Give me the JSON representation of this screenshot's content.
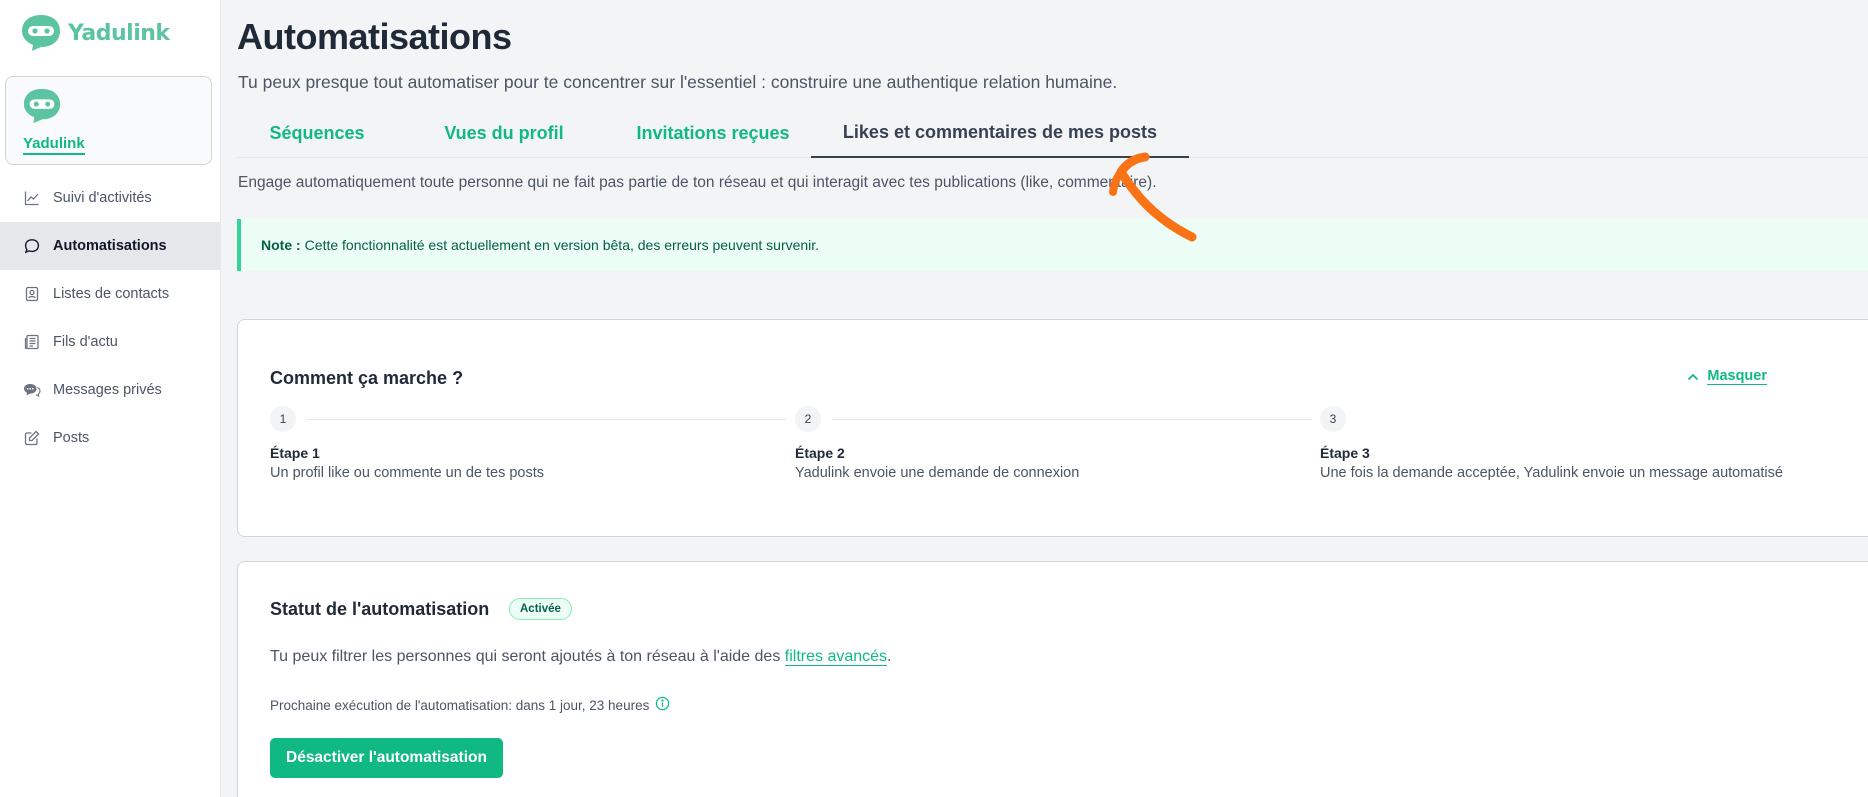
{
  "brand": {
    "name": "Yadulink",
    "color": "#5cc4a0"
  },
  "account": {
    "name": "Yadulink"
  },
  "nav": {
    "items": [
      {
        "label": "Suivi d'activités",
        "icon": "chart-line-icon"
      },
      {
        "label": "Automatisations",
        "icon": "chat-bubble-icon",
        "active": true
      },
      {
        "label": "Listes de contacts",
        "icon": "contact-book-icon"
      },
      {
        "label": "Fils d'actu",
        "icon": "newspaper-icon"
      },
      {
        "label": "Messages privés",
        "icon": "messages-icon"
      },
      {
        "label": "Posts",
        "icon": "edit-square-icon"
      }
    ]
  },
  "page": {
    "title": "Automatisations",
    "subtitle": "Tu peux presque tout automatiser pour te concentrer sur l'essentiel : construire une authentique relation humaine."
  },
  "tabs": [
    {
      "label": "Séquences"
    },
    {
      "label": "Vues du profil"
    },
    {
      "label": "Invitations reçues"
    },
    {
      "label": "Likes et commentaires de mes posts",
      "active": true
    }
  ],
  "tab_description": "Engage automatiquement toute personne qui ne fait pas partie de ton réseau et qui interagit avec tes publications (like, commentaire).",
  "note": {
    "prefix": "Note :",
    "text": "Cette fonctionnalité est actuellement en version bêta, des erreurs peuvent survenir."
  },
  "how_it_works": {
    "title": "Comment ça marche ?",
    "toggle_label": "Masquer",
    "steps": [
      {
        "number": "1",
        "title": "Étape 1",
        "desc": "Un profil like ou commente un de tes posts"
      },
      {
        "number": "2",
        "title": "Étape 2",
        "desc": "Yadulink envoie une demande de connexion"
      },
      {
        "number": "3",
        "title": "Étape 3",
        "desc": "Une fois la demande acceptée, Yadulink envoie un message automatisé"
      }
    ]
  },
  "status": {
    "title": "Statut de l'automatisation",
    "badge": "Activée",
    "filter_text_before": "Tu peux filtrer les personnes qui seront ajoutés à ton réseau à l'aide des ",
    "filter_link": "filtres avancés",
    "filter_text_after": ".",
    "next_run": "Prochaine exécution de l'automatisation: dans 1 jour, 23 heures",
    "button_label": "Désactiver l'automatisation"
  },
  "colors": {
    "accent": "#10b981",
    "annotation": "#f97316"
  }
}
